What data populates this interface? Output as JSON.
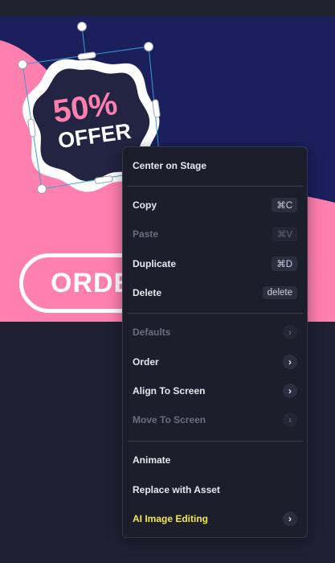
{
  "canvas": {
    "colors": {
      "navy": "#1b1f5c",
      "pink": "#ff7fae",
      "badge_bg": "#232442",
      "badge_text": "#ff7fae",
      "selection": "#3aa0d8"
    },
    "badge": {
      "line1": "50%",
      "line2": "OFFER"
    },
    "order_button_label": "ORDE"
  },
  "context_menu": {
    "center_on_stage": "Center on Stage",
    "copy": {
      "label": "Copy",
      "shortcut": "⌘C"
    },
    "paste": {
      "label": "Paste",
      "shortcut": "⌘V"
    },
    "duplicate": {
      "label": "Duplicate",
      "shortcut": "⌘D"
    },
    "delete": {
      "label": "Delete",
      "shortcut": "delete"
    },
    "defaults": "Defaults",
    "order": "Order",
    "align_to_screen": "Align To Screen",
    "move_to_screen": "Move To Screen",
    "animate": "Animate",
    "replace_with_asset": "Replace with Asset",
    "ai_image_editing": "AI Image Editing",
    "chevron_glyph": "›"
  }
}
